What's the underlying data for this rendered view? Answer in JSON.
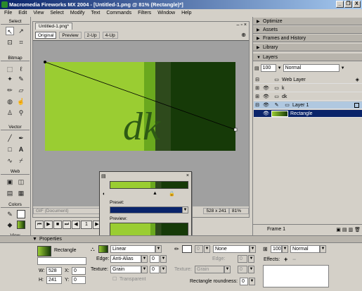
{
  "window": {
    "title": "Macromedia Fireworks MX 2004 - [Untitled-1.png @ 81% (Rectangle)*]",
    "minimize": "_",
    "restore": "❐",
    "close": "X"
  },
  "menu": [
    "File",
    "Edit",
    "View",
    "Select",
    "Modify",
    "Text",
    "Commands",
    "Filters",
    "Window",
    "Help"
  ],
  "tools": {
    "select": "Select",
    "bitmap": "Bitmap",
    "vector": "Vector",
    "web": "Web",
    "colors": "Colors",
    "view": "View"
  },
  "document": {
    "tab_name": "Untitled-1.png*",
    "view_tabs": [
      "Original",
      "Preview",
      "2-Up",
      "4-Up"
    ],
    "canvas_text": "dk",
    "status_format": "GIF (Document)",
    "status_size": "528 x 241",
    "status_zoom": "81%",
    "status_page": "1"
  },
  "popup": {
    "preset_label": "Preset:",
    "preview_label": "Preview:"
  },
  "panels": {
    "optimize": "Optimize",
    "assets": "Assets",
    "frames_history": "Frames and History",
    "library": "Library",
    "layers": "Layers"
  },
  "layers_panel": {
    "opacity": "100",
    "blend": "Normal",
    "items": [
      {
        "name": "Web Layer",
        "kind": "folder"
      },
      {
        "name": "k",
        "kind": "object"
      },
      {
        "name": "dk",
        "kind": "object"
      },
      {
        "name": "Layer 1",
        "kind": "layer"
      },
      {
        "name": "Rectangle",
        "kind": "object"
      }
    ],
    "frame": "Frame 1"
  },
  "properties": {
    "title": "Properties",
    "object_name": "Rectangle",
    "w_label": "W:",
    "w": "528",
    "h_label": "H:",
    "h": "241",
    "x_label": "X:",
    "x": "0",
    "y_label": "Y:",
    "y": "0",
    "fill_type": "Linear",
    "edge_label": "Edge:",
    "edge": "Anti-Alias",
    "edge_val": "0",
    "texture_label": "Texture:",
    "texture": "Grain",
    "texture_val": "0",
    "transparent": "Transparent",
    "stroke_size": "0",
    "stroke": "None",
    "stroke_edge_label": "Edge:",
    "stroke_edge": "0",
    "stroke_texture_label": "Texture:",
    "stroke_texture": "Grain",
    "stroke_texture_val": "0",
    "roundness_label": "Rectangle roundness:",
    "roundness": "0",
    "opacity": "100",
    "blend": "Normal",
    "effects": "Effects:"
  },
  "colors": {
    "lime": "#9acd32",
    "green": "#5a9a1a",
    "dark": "#163a08",
    "canvas_bg": "#a0a0a0"
  }
}
